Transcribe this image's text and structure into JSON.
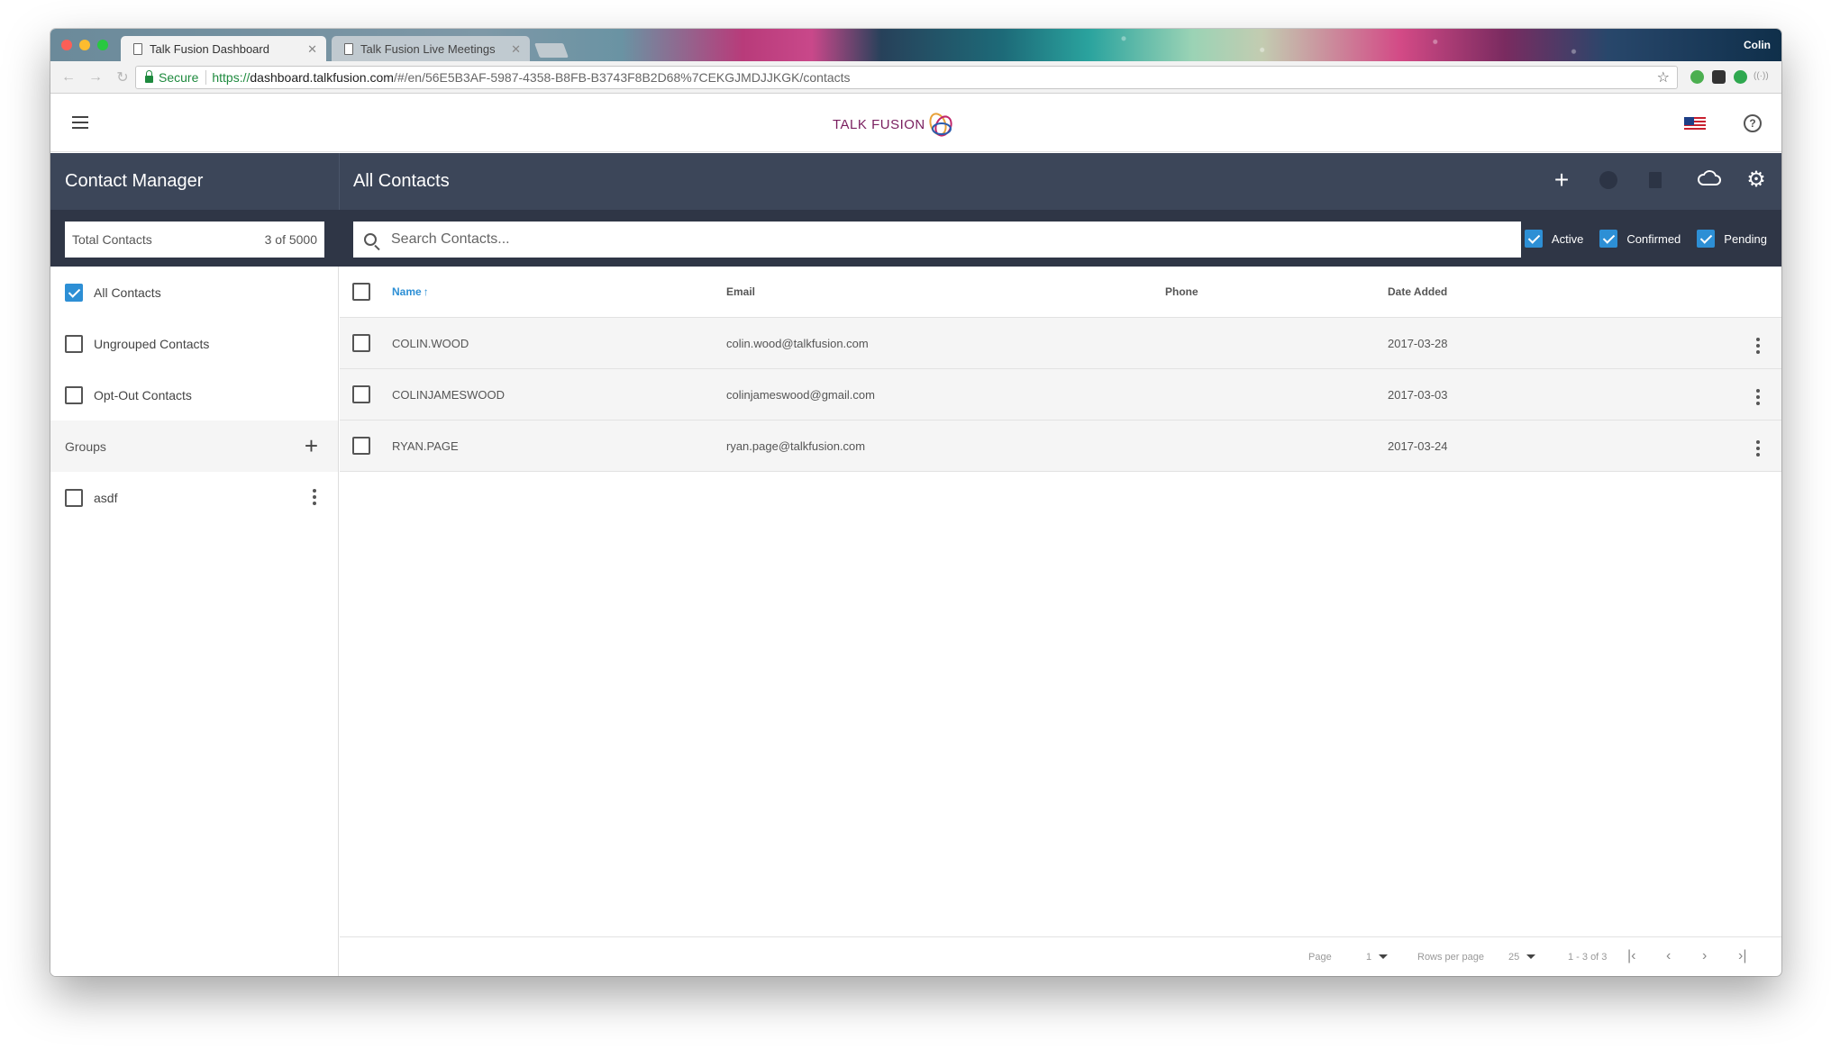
{
  "browser": {
    "tabs": [
      {
        "label": "Talk Fusion Dashboard",
        "active": true
      },
      {
        "label": "Talk Fusion Live Meetings",
        "active": false
      }
    ],
    "user": "Colin",
    "secure_label": "Secure",
    "url_scheme": "https://",
    "url_host": "dashboard.talkfusion.com",
    "url_path": "/#/en/56E5B3AF-5987-4358-B8FB-B3743F8B2D68%7CEKGJMDJJKGK/contacts"
  },
  "header": {
    "logo_text": "TALK FUSION"
  },
  "toolbar": {
    "left_title": "Contact Manager",
    "main_title": "All Contacts",
    "icons": [
      "add-icon",
      "merge-icon",
      "trash-icon",
      "cloud-icon",
      "gear-icon"
    ]
  },
  "filters": {
    "total_label": "Total Contacts",
    "total_value": "3 of 5000",
    "search_placeholder": "Search Contacts...",
    "statuses": [
      {
        "label": "Active",
        "checked": true
      },
      {
        "label": "Confirmed",
        "checked": true
      },
      {
        "label": "Pending",
        "checked": true
      }
    ]
  },
  "sidebar": {
    "items": [
      {
        "label": "All Contacts",
        "checked": true
      },
      {
        "label": "Ungrouped Contacts",
        "checked": false
      },
      {
        "label": "Opt-Out Contacts",
        "checked": false
      }
    ],
    "groups_label": "Groups",
    "groups": [
      {
        "label": "asdf",
        "checked": false
      }
    ]
  },
  "table": {
    "columns": [
      "Name",
      "Email",
      "Phone",
      "Date Added"
    ],
    "rows": [
      {
        "name": "COLIN.WOOD",
        "email": "colin.wood@talkfusion.com",
        "phone": "",
        "date": "2017-03-28"
      },
      {
        "name": "COLINJAMESWOOD",
        "email": "colinjameswood@gmail.com",
        "phone": "",
        "date": "2017-03-03"
      },
      {
        "name": "RYAN.PAGE",
        "email": "ryan.page@talkfusion.com",
        "phone": "",
        "date": "2017-03-24"
      }
    ]
  },
  "pagination": {
    "page_label": "Page",
    "page_value": "1",
    "rows_label": "Rows per page",
    "rows_value": "25",
    "range": "1 - 3 of 3"
  },
  "colors": {
    "dark_bar": "#3c4659",
    "filter_bar": "#2f3646",
    "accent": "#2d8fd5"
  }
}
